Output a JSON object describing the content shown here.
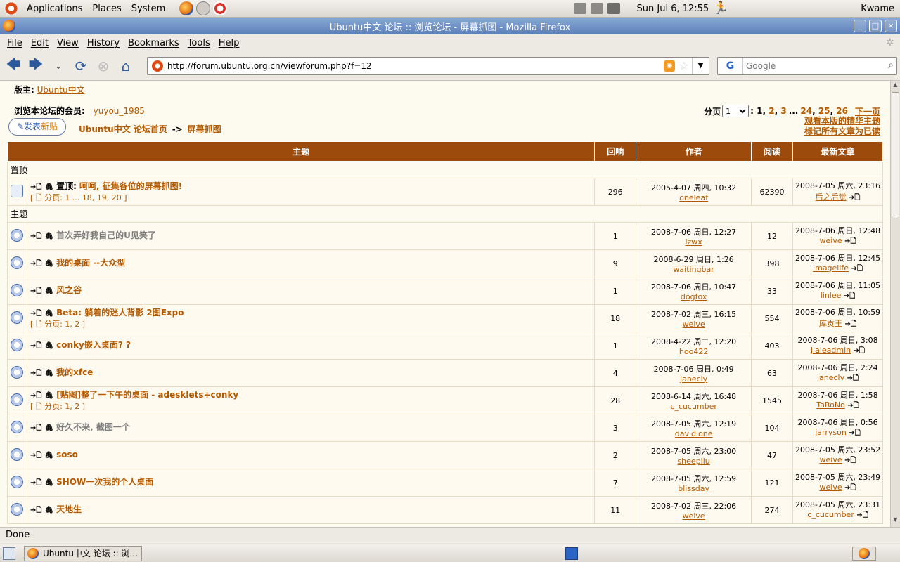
{
  "gnome_panel": {
    "menus": [
      "Applications",
      "Places",
      "System"
    ],
    "clock": "Sun Jul  6, 12:55",
    "user": "Kwame"
  },
  "window": {
    "title": "Ubuntu中文 论坛 :: 浏览论坛 - 屏幕抓图 - Mozilla Firefox"
  },
  "menubar": [
    "File",
    "Edit",
    "View",
    "History",
    "Bookmarks",
    "Tools",
    "Help"
  ],
  "navbar": {
    "url": "http://forum.ubuntu.org.cn/viewforum.php?f=12",
    "search_placeholder": "Google"
  },
  "page": {
    "moderator_label": "版主:",
    "moderator": "Ubuntu中文",
    "members_label": "浏览本论坛的会员:",
    "members": "yuyou_1985",
    "pages_label": "分页",
    "pages_select": "1",
    "pages_links": [
      "1",
      "2",
      "3",
      "...",
      "24",
      "25",
      "26"
    ],
    "next_page": "下一页",
    "new_post_a": "发表",
    "new_post_b": "新贴",
    "breadcrumb_home": "Ubuntu中文 论坛首页",
    "breadcrumb_sep": "->",
    "breadcrumb_forum": "屏幕抓图",
    "link_featured": "观看本版的精华主题",
    "link_mark_read": "标记所有文章为已读",
    "columns": [
      "主题",
      "回响",
      "作者",
      "阅读",
      "最新文章"
    ],
    "section_sticky": "置顶",
    "section_topics": "主题"
  },
  "sticky": [
    {
      "prefix": "置顶:",
      "title": "呵呵, 征集各位的屏幕抓图!",
      "pages": "[ 🗋 分页: 1 ... 18, 19, 20 ]",
      "replies": "296",
      "author_date": "2005-4-07 周四, 10:32",
      "author": "oneleaf",
      "views": "62390",
      "last_date": "2008-7-05 周六, 23:16",
      "last_user": "后之后觉"
    }
  ],
  "topics": [
    {
      "title": "首次弄好我自己的U见笑了",
      "grey": true,
      "pages": "",
      "replies": "1",
      "author_date": "2008-7-06 周日, 12:27",
      "author": "lzwx",
      "views": "12",
      "last_date": "2008-7-06 周日, 12:48",
      "last_user": "weive"
    },
    {
      "title": "我的桌面 --大众型",
      "grey": false,
      "pages": "",
      "replies": "9",
      "author_date": "2008-6-29 周日, 1:26",
      "author": "waitingbar",
      "views": "398",
      "last_date": "2008-7-06 周日, 12:45",
      "last_user": "imagelife"
    },
    {
      "title": "风之谷",
      "grey": false,
      "pages": "",
      "replies": "1",
      "author_date": "2008-7-06 周日, 10:47",
      "author": "dogfox",
      "views": "33",
      "last_date": "2008-7-06 周日, 11:05",
      "last_user": "linlee"
    },
    {
      "title": "Beta: 躺着的迷人背影 2图Expo",
      "grey": false,
      "pages": "[ 🗋 分页: 1, 2 ]",
      "replies": "18",
      "author_date": "2008-7-02 周三, 16:15",
      "author": "weive",
      "views": "554",
      "last_date": "2008-7-06 周日, 10:59",
      "last_user": "库贡王"
    },
    {
      "title": "conky嵌入桌面? ?",
      "grey": false,
      "pages": "",
      "replies": "1",
      "author_date": "2008-4-22 周二, 12:20",
      "author": "hoo422",
      "views": "403",
      "last_date": "2008-7-06 周日, 3:08",
      "last_user": "jialeadmin"
    },
    {
      "title": "我的xfce",
      "grey": false,
      "pages": "",
      "replies": "4",
      "author_date": "2008-7-06 周日, 0:49",
      "author": "janecly",
      "views": "63",
      "last_date": "2008-7-06 周日, 2:24",
      "last_user": "janecly"
    },
    {
      "title": "[贴图]整了一下午的桌面 - adesklets+conky",
      "grey": false,
      "pages": "[ 🗋 分页: 1, 2 ]",
      "replies": "28",
      "author_date": "2008-6-14 周六, 16:48",
      "author": "c_cucumber",
      "views": "1545",
      "last_date": "2008-7-06 周日, 1:58",
      "last_user": "TaRoNo"
    },
    {
      "title": "好久不来, 截图一个",
      "grey": true,
      "pages": "",
      "replies": "3",
      "author_date": "2008-7-05 周六, 12:19",
      "author": "davidlone",
      "views": "104",
      "last_date": "2008-7-06 周日, 0:56",
      "last_user": "jarryson"
    },
    {
      "title": "soso",
      "grey": false,
      "pages": "",
      "replies": "2",
      "author_date": "2008-7-05 周六, 23:00",
      "author": "sheepliu",
      "views": "47",
      "last_date": "2008-7-05 周六, 23:52",
      "last_user": "weive"
    },
    {
      "title": "SHOW一次我的个人桌面",
      "grey": false,
      "pages": "",
      "replies": "7",
      "author_date": "2008-7-05 周六, 12:59",
      "author": "blissday",
      "views": "121",
      "last_date": "2008-7-05 周六, 23:49",
      "last_user": "weive"
    },
    {
      "title": "天地生",
      "grey": false,
      "pages": "",
      "replies": "11",
      "author_date": "2008-7-02 周三, 22:06",
      "author": "weive",
      "views": "274",
      "last_date": "2008-7-05 周六, 23:31",
      "last_user": "c_cucumber"
    }
  ],
  "statusbar": "Done",
  "taskbar": {
    "task": "Ubuntu中文 论坛 :: 浏..."
  }
}
